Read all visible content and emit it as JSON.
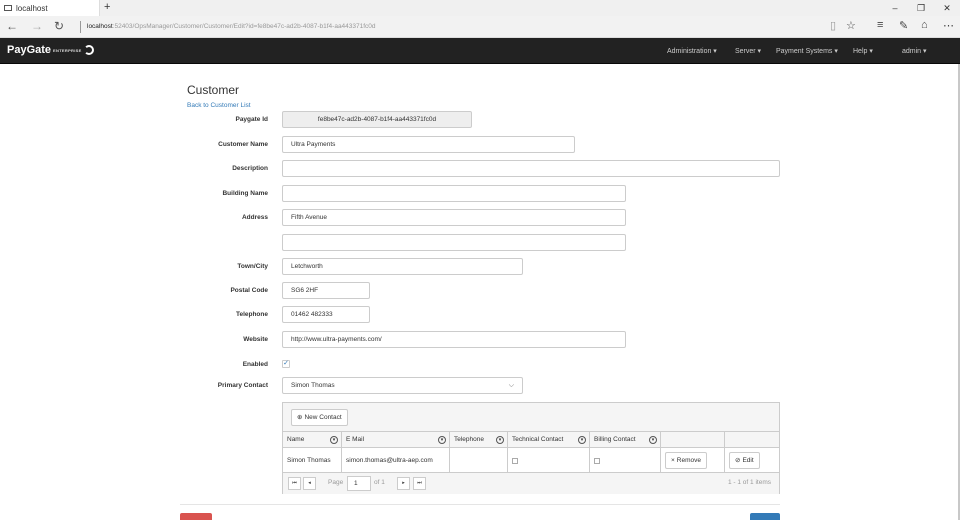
{
  "browser": {
    "tab_title": "localhost",
    "new_tab": "+",
    "url_host": "localhost",
    "url_path": ":52403/OpsManager/Customer/Customer/Edit?id=fe8be47c-ad2b-4087-b1f4-aa443371fc0d",
    "win_min": "–",
    "win_max": "❐",
    "win_close": "✕"
  },
  "app": {
    "brand": "PayGate",
    "brand_sub": "ENTERPRISE",
    "menu": {
      "administration": "Administration ▾",
      "server": "Server ▾",
      "payment_systems": "Payment Systems ▾",
      "help": "Help ▾",
      "admin": "admin ▾"
    }
  },
  "page": {
    "title": "Customer",
    "back_link": "Back to Customer List"
  },
  "form": {
    "paygate_id": {
      "label": "Paygate Id",
      "value": "fe8be47c-ad2b-4087-b1f4-aa443371fc0d"
    },
    "customer_name": {
      "label": "Customer Name",
      "value": "Ultra Payments"
    },
    "description": {
      "label": "Description",
      "value": ""
    },
    "building_name": {
      "label": "Building Name",
      "value": ""
    },
    "address": {
      "label": "Address",
      "value": "Fifth Avenue",
      "value2": ""
    },
    "town_city": {
      "label": "Town/City",
      "value": "Letchworth"
    },
    "postal_code": {
      "label": "Postal Code",
      "value": "SG6 2HF"
    },
    "telephone": {
      "label": "Telephone",
      "value": "01462 482333"
    },
    "website": {
      "label": "Website",
      "value": "http://www.ultra-payments.com/"
    },
    "enabled": {
      "label": "Enabled",
      "checked": true,
      "mark": "✓"
    },
    "primary_contact": {
      "label": "Primary Contact",
      "value": "Simon Thomas"
    }
  },
  "contacts_grid": {
    "new_contact": "New Contact",
    "columns": [
      "Name",
      "E Mail",
      "Telephone",
      "Technical Contact",
      "Billing Contact"
    ],
    "rows": [
      {
        "name": "Simon Thomas",
        "email": "simon.thomas@ultra-aep.com",
        "telephone": "",
        "technical": false,
        "billing": false,
        "remove": "Remove",
        "edit": "Edit"
      }
    ],
    "pager": {
      "page_label": "Page",
      "page": "1",
      "of": "of 1",
      "summary": "1 - 1 of 1 items"
    }
  }
}
